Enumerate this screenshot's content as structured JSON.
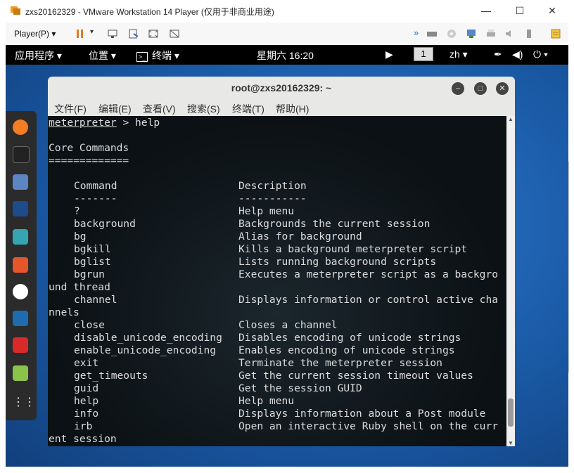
{
  "vm": {
    "title": "zxs20162329 - VMware Workstation 14 Player (仅用于非商业用途)",
    "player_label": "Player(P)",
    "min": "—",
    "max": "☐",
    "close": "✕"
  },
  "gnome": {
    "apps": "应用程序",
    "places": "位置",
    "terminal": "终端",
    "clock": "星期六 16:20",
    "workspace": "1",
    "lang": "zh"
  },
  "terminal": {
    "title": "root@zxs20162329: ~",
    "menus": [
      "文件(F)",
      "编辑(E)",
      "查看(V)",
      "搜索(S)",
      "终端(T)",
      "帮助(H)"
    ],
    "prompt_word": "meterpreter",
    "prompt_rest": " > help",
    "section": "Core Commands",
    "section_rule": "=============",
    "col_headers": [
      "Command",
      "Description"
    ],
    "col_rules": [
      "-------",
      "-----------"
    ],
    "rows": [
      [
        "?",
        "Help menu"
      ],
      [
        "background",
        "Backgrounds the current session"
      ],
      [
        "bg",
        "Alias for background"
      ],
      [
        "bgkill",
        "Kills a background meterpreter script"
      ],
      [
        "bglist",
        "Lists running background scripts"
      ],
      [
        "bgrun",
        "Executes a meterpreter script as a backgro"
      ],
      [
        "channel",
        "Displays information or control active cha"
      ],
      [
        "close",
        "Closes a channel"
      ],
      [
        "disable_unicode_encoding",
        "Disables encoding of unicode strings"
      ],
      [
        "enable_unicode_encoding",
        "Enables encoding of unicode strings"
      ],
      [
        "exit",
        "Terminate the meterpreter session"
      ],
      [
        "get_timeouts",
        "Get the current session timeout values"
      ],
      [
        "guid",
        "Get the session GUID"
      ],
      [
        "help",
        "Help menu"
      ],
      [
        "info",
        "Displays information about a Post module"
      ],
      [
        "irb",
        "Open an interactive Ruby shell on the curr"
      ]
    ],
    "wrap_bgrun": "und thread",
    "wrap_channel": "nnels",
    "wrap_irb": "ent session"
  }
}
